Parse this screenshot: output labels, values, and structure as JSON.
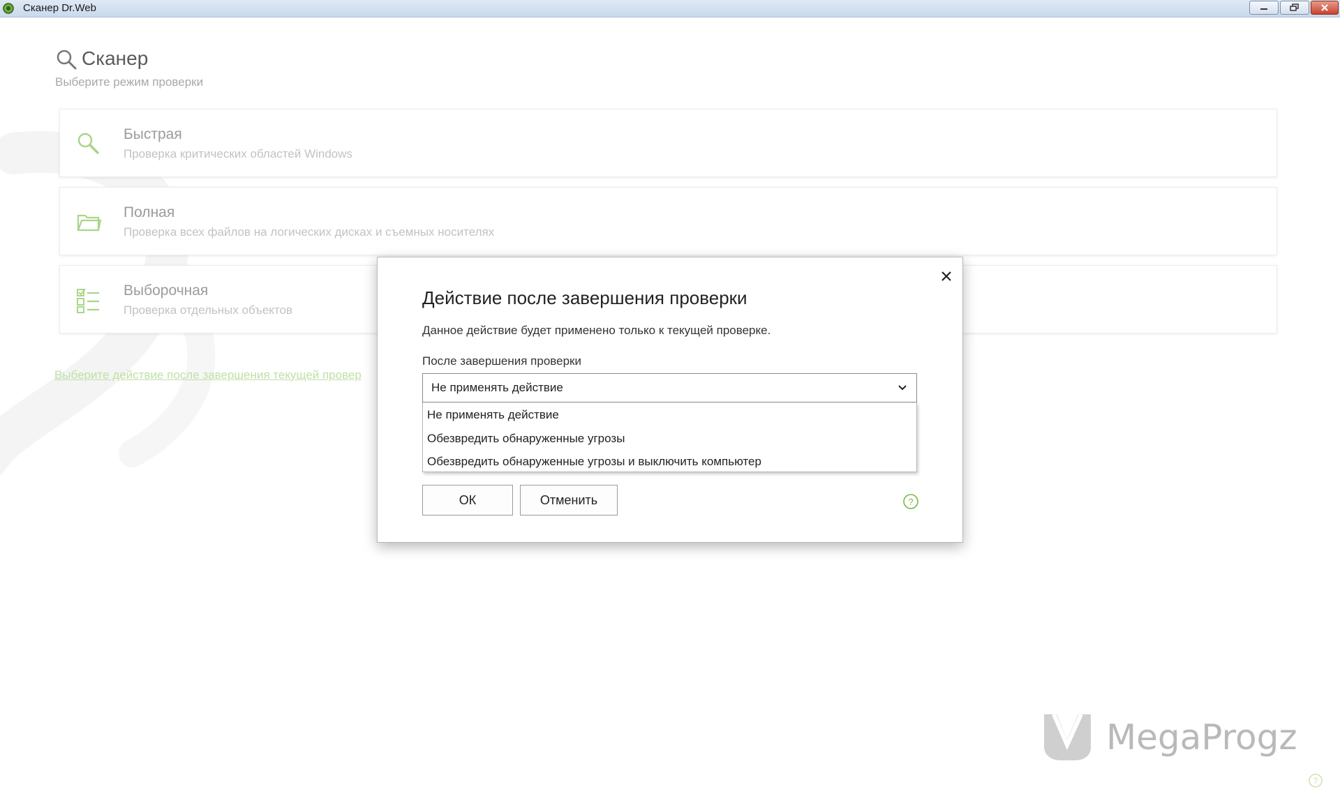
{
  "window": {
    "title": "Сканер Dr.Web",
    "icon": "drweb-spider-icon"
  },
  "header": {
    "title": "Сканер",
    "subtitle": "Выберите режим проверки"
  },
  "modes": [
    {
      "name": "Быстрая",
      "description": "Проверка критических областей Windows",
      "icon": "search-icon"
    },
    {
      "name": "Полная",
      "description": "Проверка всех файлов на логических дисках и съемных носителях",
      "icon": "folder-icon"
    },
    {
      "name": "Выборочная",
      "description": "Проверка отдельных объектов",
      "icon": "checklist-icon"
    }
  ],
  "after_scan_link": "Выберите действие после завершения текущей провер",
  "dialog": {
    "title": "Действие после завершения проверки",
    "info": "Данное действие будет применено только к текущей проверке.",
    "label": "После завершения проверки",
    "selected": "Не применять действие",
    "options": [
      "Не применять действие",
      "Обезвредить обнаруженные угрозы",
      "Обезвредить обнаруженные угрозы и выключить компьютер"
    ],
    "ok_label": "ОК",
    "cancel_label": "Отменить"
  },
  "watermark": {
    "text": "MegaProgz"
  },
  "colors": {
    "accent_green": "#7ab648",
    "link_green": "#bfe0a7",
    "title_bar": "#c9d9ec"
  }
}
